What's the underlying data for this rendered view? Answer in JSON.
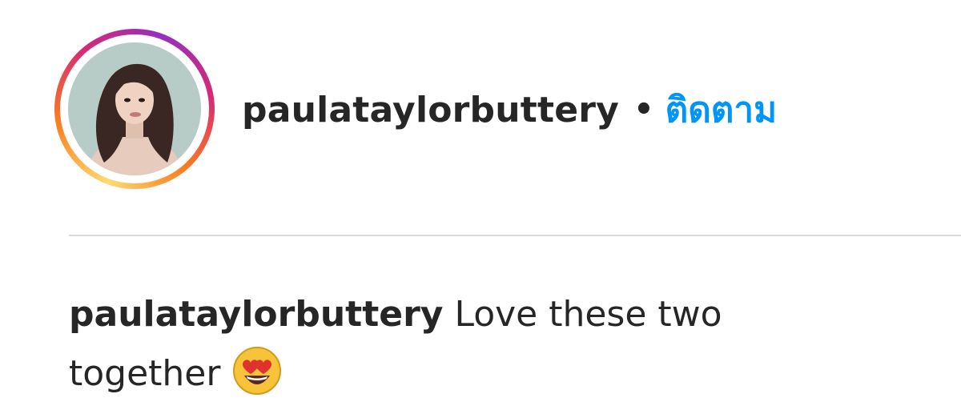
{
  "post": {
    "username": "paulataylorbuttery",
    "separator": "•",
    "follow_label": "ติดตาม",
    "avatar_icon": "profile-photo",
    "story_ring_colors": [
      "#feda75",
      "#fa7e1e",
      "#d62976",
      "#962fbf"
    ]
  },
  "caption": {
    "username": "paulataylorbuttery",
    "text": "Love these two together",
    "emoji_icon": "heart-eyes-emoji",
    "emoji_glyph": "😍"
  },
  "colors": {
    "text": "#262626",
    "link": "#0095f6",
    "divider": "#dbdbdb"
  }
}
